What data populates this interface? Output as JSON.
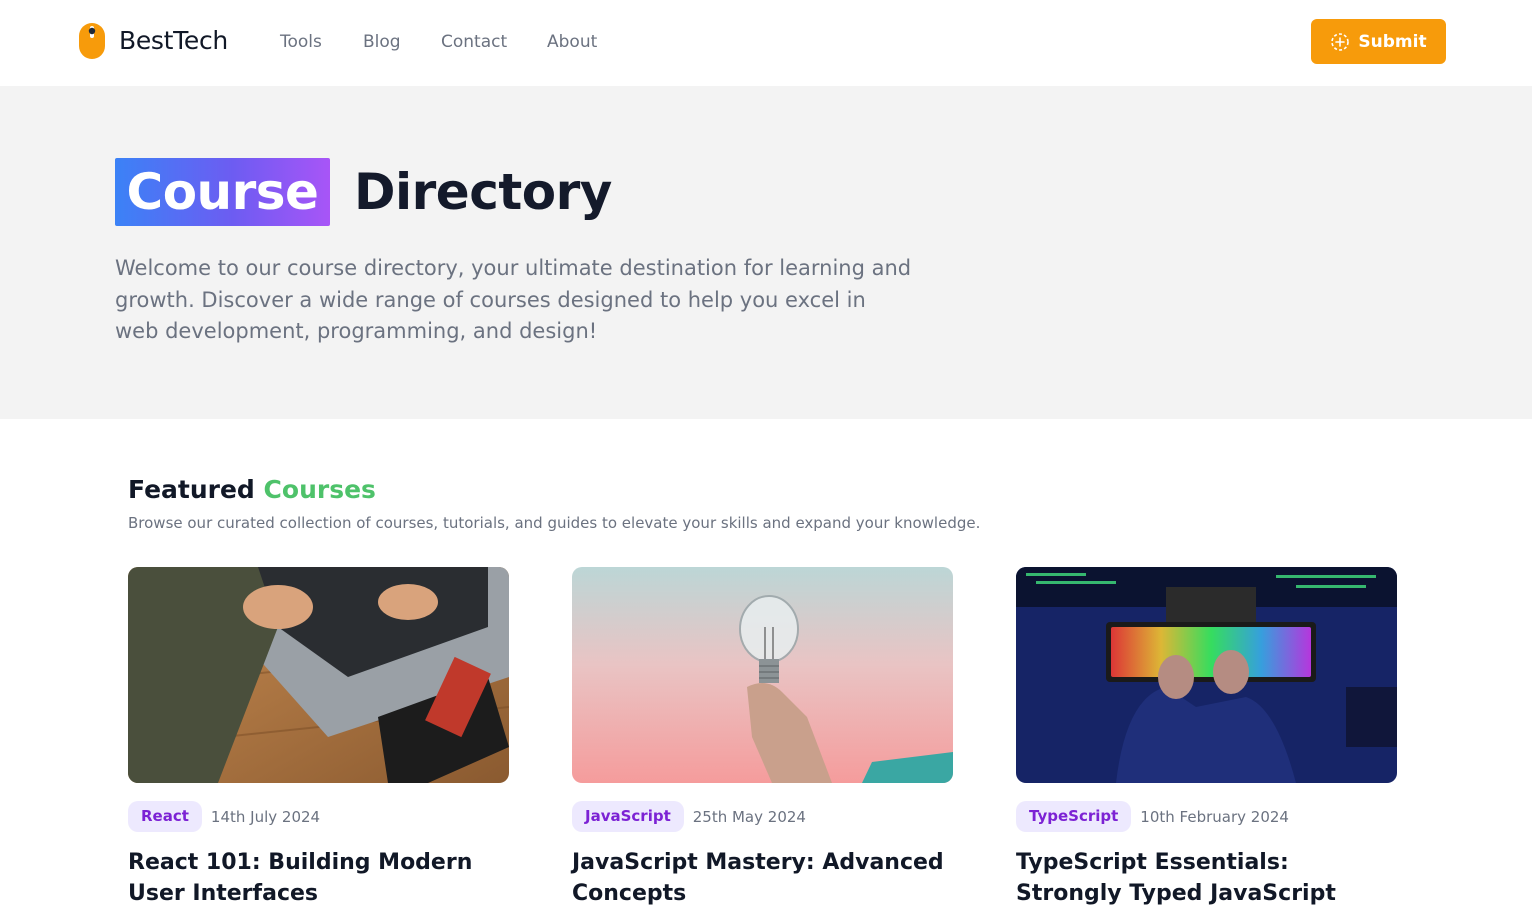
{
  "header": {
    "brand": "BestTech",
    "nav": [
      "Tools",
      "Blog",
      "Contact",
      "About"
    ],
    "submit_label": "Submit"
  },
  "hero": {
    "title_highlight": "Course",
    "title_rest": "Directory",
    "description": "Welcome to our course directory, your ultimate destination for learning and growth. Discover a wide range of courses designed to help you excel in web development, programming, and design!"
  },
  "featured": {
    "title_main": "Featured",
    "title_accent": "Courses",
    "subtitle": "Browse our curated collection of courses, tutorials, and guides to elevate your skills and expand your knowledge."
  },
  "courses": [
    {
      "tag": "React",
      "date": "14th July 2024",
      "title": "React 101: Building Modern User Interfaces"
    },
    {
      "tag": "JavaScript",
      "date": "25th May 2024",
      "title": "JavaScript Mastery: Advanced Concepts"
    },
    {
      "tag": "TypeScript",
      "date": "10th February 2024",
      "title": "TypeScript Essentials: Strongly Typed JavaScript"
    }
  ],
  "colors": {
    "accent_orange": "#f79b0b",
    "accent_green": "#4ec26a",
    "tag_bg": "#ede9fe",
    "tag_text": "#7c22d4"
  }
}
